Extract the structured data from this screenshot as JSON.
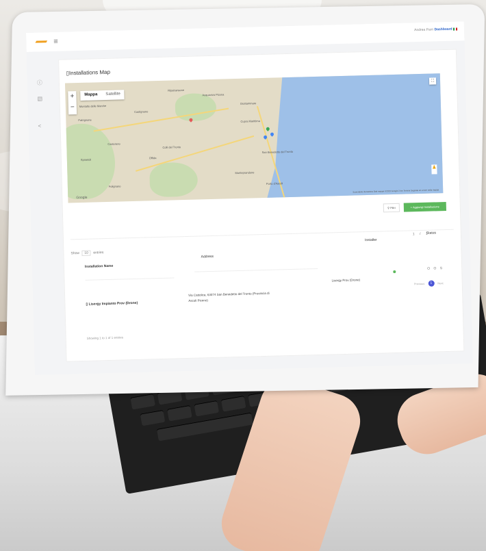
{
  "header": {
    "user_text": "Andrea Parri",
    "dashboard_link": "Dashboard"
  },
  "panel": {
    "title": "Installations Map"
  },
  "map": {
    "tab_map": "Mappa",
    "tab_satellite": "Satellite",
    "zoom_in": "+",
    "zoom_out": "−",
    "google_label": "Google",
    "footer_text": "Scorciatoie da tastiera  Dati mappa ©2023 Google  2 km  Termini  Segnala un errore nella mappa",
    "towns": [
      "Ripatransone",
      "Acquaviva Picena",
      "Grottammare",
      "Montalto delle Marche",
      "Castignano",
      "Patrignone",
      "Cupra Marittima",
      "San Benedetto del Tronto",
      "Offida",
      "Monteprandone",
      "Porto d'Ascoli",
      "Colli del Tronto",
      "Castorano",
      "Spinetoli",
      "Folignano"
    ],
    "marker_colors": [
      "#3aa757",
      "#4285f4",
      "#e9a20a"
    ]
  },
  "actions": {
    "filter_label": "Filtri",
    "add_button": "+ Aggiungi Installazione"
  },
  "table": {
    "show_label": "Show",
    "show_value": "10",
    "entries_label": "entries",
    "columns": [
      "Installation Name",
      "Address",
      "Installer",
      "Status"
    ],
    "page_numbers": "1 / 1",
    "rows": [
      {
        "name": "Lisergy Impianto Prov (Drone)",
        "address": "Via Cattolica, 63074 San Benedetto del Tronto (Provincia di Ascoli Piceno)",
        "installer": "Lisergy Prov (Drone)",
        "actions": "O O S"
      }
    ],
    "showing_text": "Showing 1 to 1 of 1 entries",
    "pager_prev": "Previous",
    "pager_current": "1",
    "pager_next": "Next"
  }
}
